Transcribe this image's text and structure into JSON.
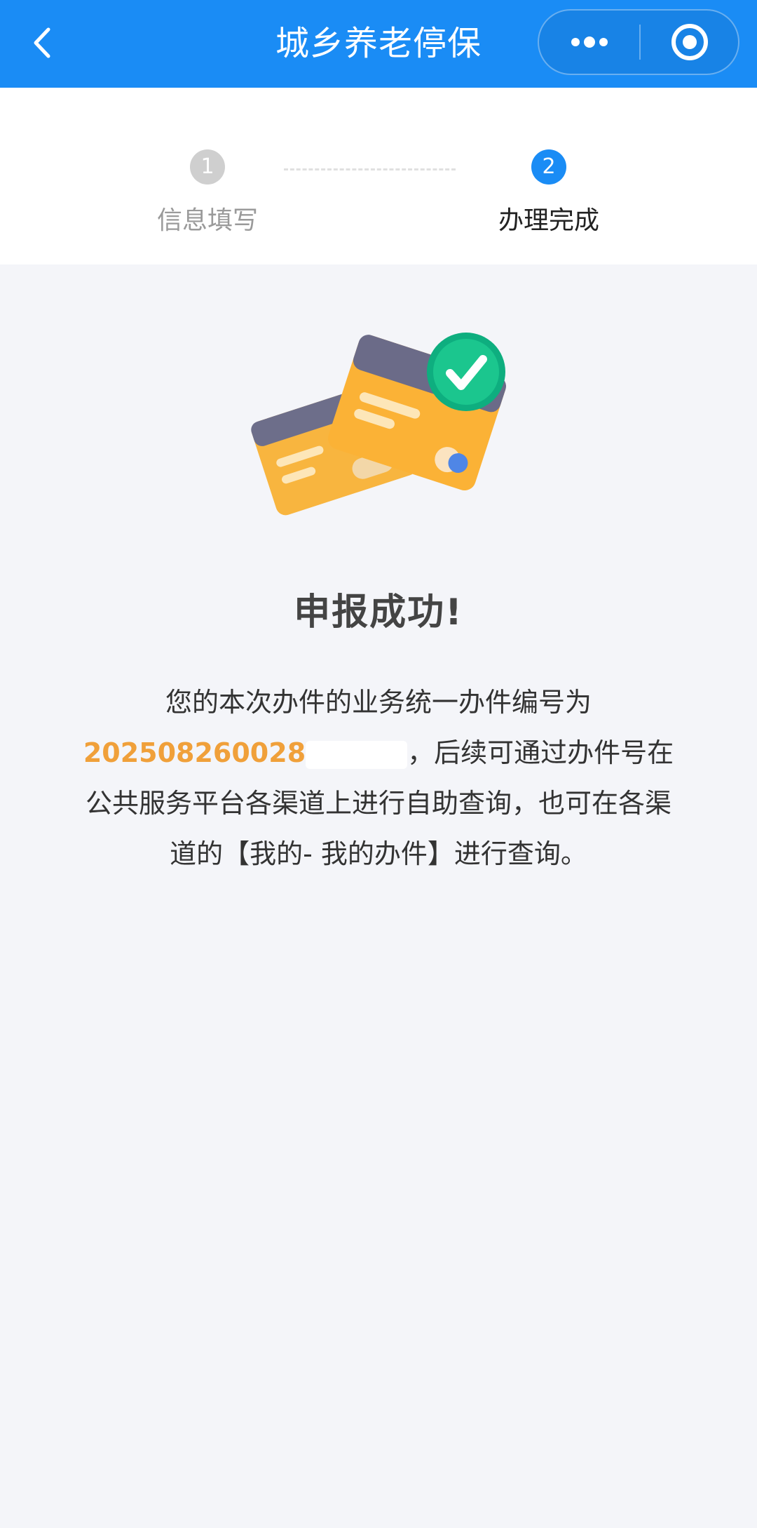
{
  "header": {
    "title": "城乡养老停保",
    "back_icon": "chevron-left-icon",
    "more_icon": "more-dots-icon",
    "close_icon": "target-close-icon",
    "bg_color": "#1a8cf5"
  },
  "steps": [
    {
      "number": "1",
      "label": "信息填写",
      "state": "done"
    },
    {
      "number": "2",
      "label": "办理完成",
      "state": "active"
    }
  ],
  "result": {
    "illustration_icon": "success-cards-icon",
    "title": "申报成功!",
    "desc_prefix": "您的本次办件的业务统一办件编号为",
    "case_number": "202508260028",
    "desc_suffix": "，后续可通过办件号在公共服务平台各渠道上进行自助查询，也可在各渠道的【我的- 我的办件】进行查询。",
    "accent_color": "#f0a03a"
  }
}
